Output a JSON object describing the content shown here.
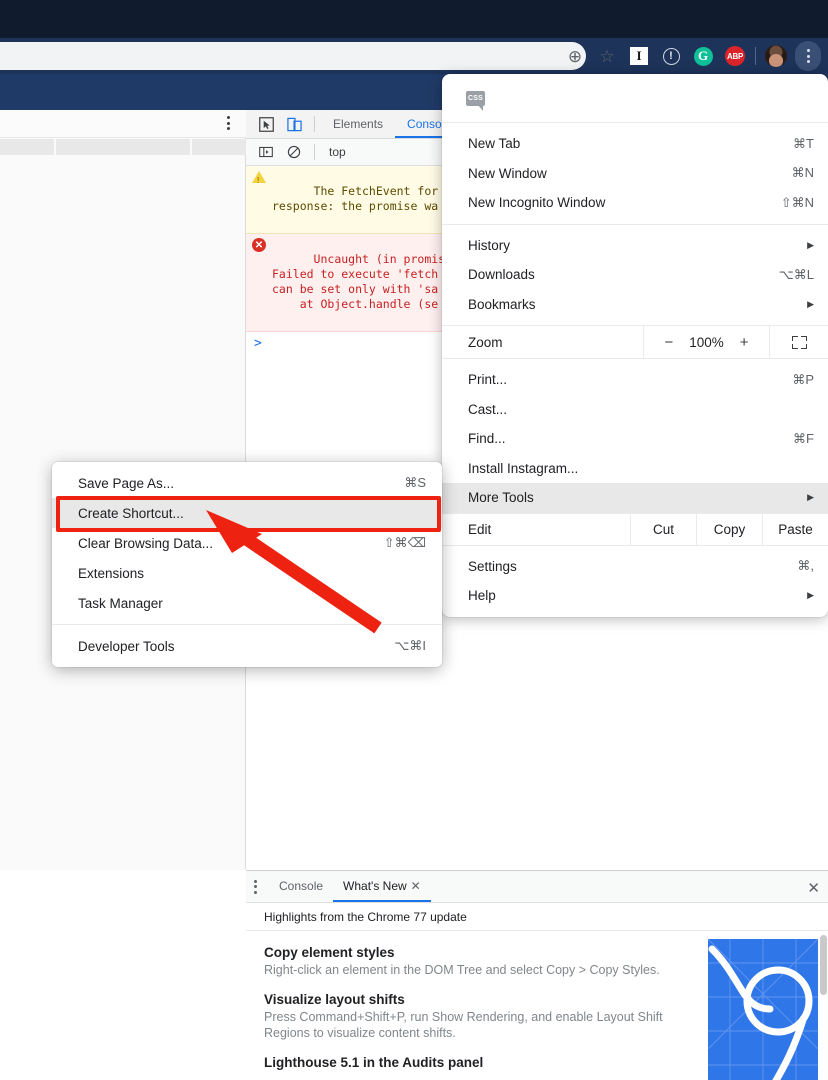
{
  "browser": {
    "toolbar_icons": [
      {
        "name": "add-to-desktop-icon",
        "glyph": "⊕"
      },
      {
        "name": "bookmark-star-icon",
        "glyph": "☆"
      },
      {
        "name": "extension-instapaper-icon",
        "glyph": "I"
      },
      {
        "name": "extension-info-icon",
        "glyph": "!"
      },
      {
        "name": "extension-grammarly-icon",
        "glyph": "G"
      },
      {
        "name": "extension-adblockplus-icon",
        "glyph": "ABP"
      },
      {
        "name": "profile-avatar",
        "glyph": ""
      },
      {
        "name": "chrome-menu-kebab-icon",
        "glyph": "⋮"
      }
    ]
  },
  "menu": {
    "header_icon_label": "CSS",
    "sections": [
      {
        "items": [
          {
            "label": "New Tab",
            "accel": "⌘T",
            "submenu": false,
            "highlight": false
          },
          {
            "label": "New Window",
            "accel": "⌘N",
            "submenu": false,
            "highlight": false
          },
          {
            "label": "New Incognito Window",
            "accel": "⇧⌘N",
            "submenu": false,
            "highlight": false
          }
        ]
      },
      {
        "items": [
          {
            "label": "History",
            "accel": "",
            "submenu": true,
            "highlight": false
          },
          {
            "label": "Downloads",
            "accel": "⌥⌘L",
            "submenu": false,
            "highlight": false
          },
          {
            "label": "Bookmarks",
            "accel": "",
            "submenu": true,
            "highlight": false
          }
        ]
      }
    ],
    "zoom": {
      "label": "Zoom",
      "minus": "−",
      "level": "100%",
      "plus": "+",
      "fullscreen_icon": "fullscreen-icon"
    },
    "section3": [
      {
        "label": "Print...",
        "accel": "⌘P",
        "submenu": false,
        "highlight": false
      },
      {
        "label": "Cast...",
        "accel": "",
        "submenu": false,
        "highlight": false
      },
      {
        "label": "Find...",
        "accel": "⌘F",
        "submenu": false,
        "highlight": false
      },
      {
        "label": "Install Instagram...",
        "accel": "",
        "submenu": false,
        "highlight": false
      },
      {
        "label": "More Tools",
        "accel": "",
        "submenu": true,
        "highlight": true
      }
    ],
    "edit_row": {
      "label": "Edit",
      "buttons": [
        "Cut",
        "Copy",
        "Paste"
      ]
    },
    "section4": [
      {
        "label": "Settings",
        "accel": "⌘,",
        "submenu": false,
        "highlight": false
      },
      {
        "label": "Help",
        "accel": "",
        "submenu": true,
        "highlight": false
      }
    ]
  },
  "submenu": {
    "items": [
      {
        "label": "Save Page As...",
        "accel": "⌘S",
        "highlight": false
      },
      {
        "label": "Create Shortcut...",
        "accel": "",
        "highlight": true
      },
      {
        "label": "Clear Browsing Data...",
        "accel": "⇧⌘⌫",
        "highlight": false
      },
      {
        "label": "Extensions",
        "accel": "",
        "highlight": false
      },
      {
        "label": "Task Manager",
        "accel": "",
        "highlight": false
      }
    ],
    "footer": [
      {
        "label": "Developer Tools",
        "accel": "⌥⌘I",
        "highlight": false
      }
    ]
  },
  "devtools": {
    "tabs": [
      {
        "label": "Elements",
        "active": false
      },
      {
        "label": "Console",
        "active": true
      }
    ],
    "context": "top",
    "console": {
      "warning": "The FetchEvent for \"http\nresponse: the promise wa",
      "warning_lines": [
        "The FetchEvent for \"http",
        "response: the promise wa"
      ],
      "error_lines": [
        "Uncaught (in promise) Ty",
        "Failed to execute 'fetch",
        "can be set only with 'sa",
        "    at Object.handle (se"
      ],
      "prompt": ">"
    }
  },
  "drawer": {
    "tabs": [
      {
        "label": "Console",
        "active": false,
        "closable": false
      },
      {
        "label": "What's New",
        "active": true,
        "closable": true
      }
    ],
    "close_glyph": "✕",
    "subtitle": "Highlights from the Chrome 77 update",
    "entries": [
      {
        "title": "Copy element styles",
        "desc": "Right-click an element in the DOM Tree and select Copy > Copy Styles."
      },
      {
        "title": "Visualize layout shifts",
        "desc": "Press Command+Shift+P, run Show Rendering, and enable Layout Shift Regions to visualize content shifts."
      },
      {
        "title": "Lighthouse 5.1 in the Audits panel",
        "desc": ""
      }
    ]
  },
  "annotation": {
    "highlight_color": "#ee2211",
    "arrow_color": "#ee2211",
    "target_label": "Create Shortcut..."
  },
  "colors": {
    "os_top": "#101c2e",
    "toolbar": "#1d3359",
    "page_band": "#203a67",
    "accent_blue": "#1a73e8",
    "menu_highlight": "#e8e8e8"
  }
}
